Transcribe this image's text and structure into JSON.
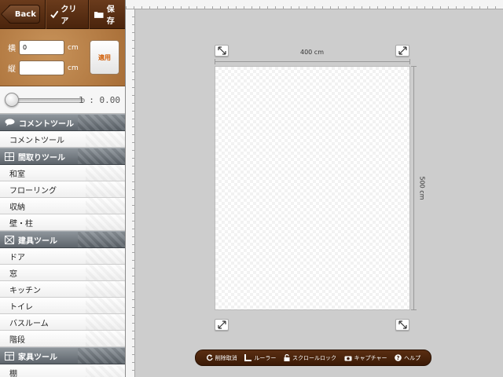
{
  "toolbar": {
    "back_label": "Back",
    "clear_label": "クリア",
    "save_label": "保存"
  },
  "size_panel": {
    "width_label": "横",
    "width_value": "0",
    "width_unit": "cm",
    "height_label": "縦",
    "height_value": "",
    "height_unit": "cm",
    "apply_label": "適用"
  },
  "zoom": {
    "ratio_text": "1 : 0.00",
    "slider_level": 0
  },
  "sections": {
    "comment": {
      "title": "コメントツール",
      "icon": "speech-bubble-icon",
      "items": [
        "コメントツール"
      ]
    },
    "layout": {
      "title": "間取りツール",
      "icon": "floorplan-grid-icon",
      "items": [
        "和室",
        "フローリング",
        "収納",
        "壁・柱"
      ]
    },
    "fixtures": {
      "title": "建具ツール",
      "icon": "door-box-icon",
      "items": [
        "ドア",
        "窓",
        "キッチン",
        "トイレ",
        "バスルーム",
        "階段"
      ]
    },
    "furniture": {
      "title": "家具ツール",
      "icon": "furniture-grid-icon",
      "items": [
        "棚"
      ]
    }
  },
  "canvas": {
    "width_dim_label": "400 cm",
    "height_dim_label": "500 cm"
  },
  "bottom_bar": {
    "undo_label": "削除取消",
    "ruler_label": "ルーラー",
    "scroll_lock_label": "スクロールロック",
    "capture_label": "キャプチャー",
    "help_label": "ヘルプ"
  },
  "colors": {
    "toolbar_brown": "#4a240c",
    "panel_tan": "#b57a40",
    "apply_text": "#d05a00",
    "section_header_gray": "#6b7278"
  }
}
